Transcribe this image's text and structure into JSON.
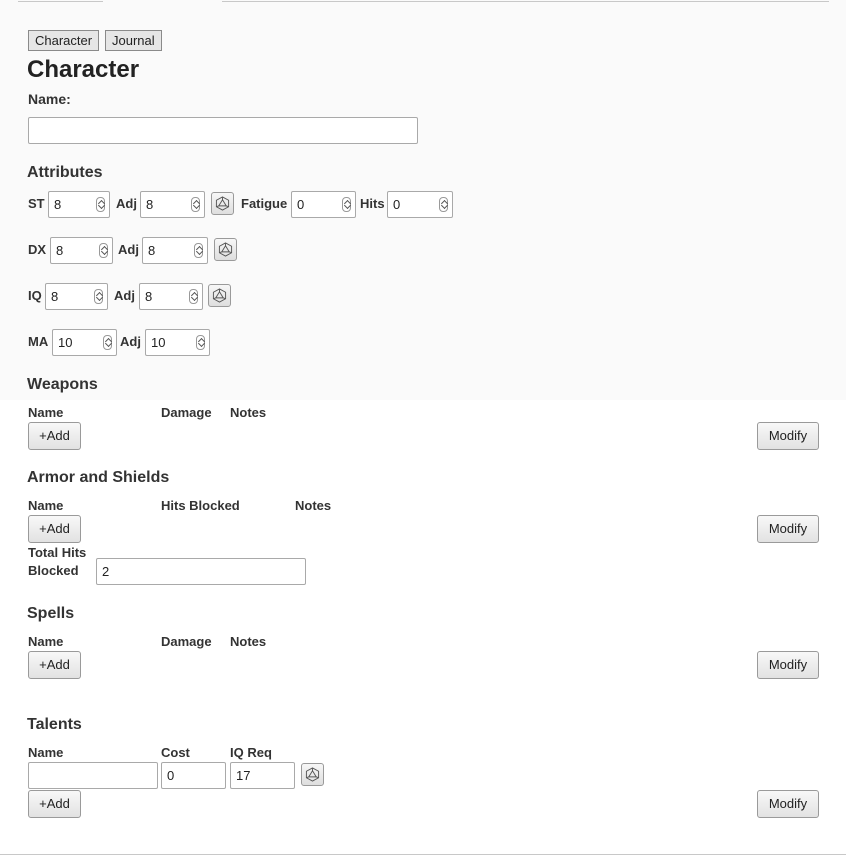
{
  "tabs": {
    "character": "Character",
    "journal": "Journal"
  },
  "page_title": "Character",
  "name": {
    "label": "Name:",
    "value": ""
  },
  "attributes": {
    "heading": "Attributes",
    "st": {
      "label": "ST",
      "value": "8",
      "adj_label": "Adj",
      "adj_value": "8"
    },
    "fatigue": {
      "label": "Fatigue",
      "value": "0"
    },
    "hits": {
      "label": "Hits",
      "value": "0"
    },
    "dx": {
      "label": "DX",
      "value": "8",
      "adj_label": "Adj",
      "adj_value": "8"
    },
    "iq": {
      "label": "IQ",
      "value": "8",
      "adj_label": "Adj",
      "adj_value": "8"
    },
    "ma": {
      "label": "MA",
      "value": "10",
      "adj_label": "Adj",
      "adj_value": "10"
    }
  },
  "weapons": {
    "heading": "Weapons",
    "columns": [
      "Name",
      "Damage",
      "Notes"
    ],
    "add_label": "+Add",
    "modify_label": "Modify"
  },
  "armor": {
    "heading": "Armor and Shields",
    "columns": [
      "Name",
      "Hits Blocked",
      "Notes"
    ],
    "add_label": "+Add",
    "modify_label": "Modify",
    "total_label_1": "Total Hits",
    "total_label_2": "Blocked",
    "total_value": "2"
  },
  "spells": {
    "heading": "Spells",
    "columns": [
      "Name",
      "Damage",
      "Notes"
    ],
    "add_label": "+Add",
    "modify_label": "Modify"
  },
  "talents": {
    "heading": "Talents",
    "columns": [
      "Name",
      "Cost",
      "IQ Req"
    ],
    "row": {
      "name": "",
      "cost": "0",
      "iq_req": "17"
    },
    "add_label": "+Add",
    "modify_label": "Modify"
  },
  "icons": {
    "roll": "d20-dice-icon"
  }
}
